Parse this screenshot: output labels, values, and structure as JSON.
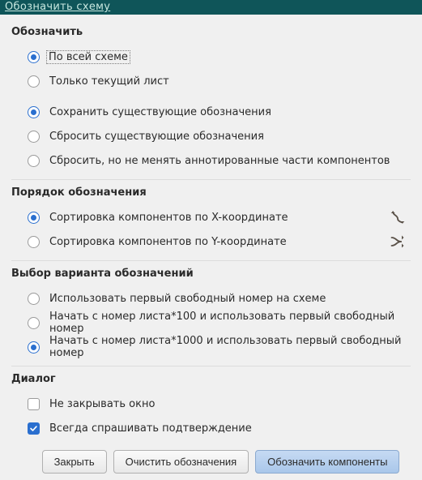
{
  "window": {
    "title": "Обозначить схему"
  },
  "annotate": {
    "label": "Обозначить",
    "scope": {
      "whole": "По всей схеме",
      "current": "Только текущий лист",
      "selected": "whole"
    },
    "existing": {
      "keep": "Сохранить существующие обозначения",
      "reset": "Сбросить существующие обозначения",
      "reset_keep_annotated": "Сбросить, но не менять аннотированные части компонентов",
      "selected": "keep"
    }
  },
  "order": {
    "label": "Порядок обозначения",
    "by_x": "Сортировка компонентов по X-координате",
    "by_y": "Сортировка компонентов по Y-координате",
    "selected": "by_x"
  },
  "variant": {
    "label": "Выбор варианта обозначений",
    "first_free": "Использовать первый свободный номер на схеме",
    "sheet_100": "Начать с номер листа*100 и использовать первый свободный номер",
    "sheet_1000": "Начать с номер листа*1000 и использовать первый свободный номер",
    "selected": "sheet_1000"
  },
  "dialog": {
    "label": "Диалог",
    "no_close": {
      "label": "Не закрывать окно",
      "checked": false
    },
    "confirm": {
      "label": "Всегда спрашивать подтверждение",
      "checked": true
    }
  },
  "buttons": {
    "close": "Закрыть",
    "clear": "Очистить обозначения",
    "annotate": "Обозначить компоненты"
  },
  "colors": {
    "titlebar_bg": "#0f5559",
    "accent": "#2a6fcf"
  }
}
